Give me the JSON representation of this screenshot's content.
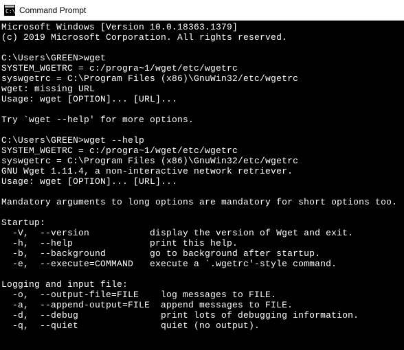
{
  "window": {
    "title": "Command Prompt",
    "icon": "cmd-icon"
  },
  "terminal": {
    "lines": [
      "Microsoft Windows [Version 10.0.18363.1379]",
      "(c) 2019 Microsoft Corporation. All rights reserved.",
      "",
      "C:\\Users\\GREEN>wget",
      "SYSTEM_WGETRC = c:/progra~1/wget/etc/wgetrc",
      "syswgetrc = C:\\Program Files (x86)\\GnuWin32/etc/wgetrc",
      "wget: missing URL",
      "Usage: wget [OPTION]... [URL]...",
      "",
      "Try `wget --help' for more options.",
      "",
      "C:\\Users\\GREEN>wget --help",
      "SYSTEM_WGETRC = c:/progra~1/wget/etc/wgetrc",
      "syswgetrc = C:\\Program Files (x86)\\GnuWin32/etc/wgetrc",
      "GNU Wget 1.11.4, a non-interactive network retriever.",
      "Usage: wget [OPTION]... [URL]...",
      "",
      "Mandatory arguments to long options are mandatory for short options too.",
      "",
      "Startup:",
      "  -V,  --version           display the version of Wget and exit.",
      "  -h,  --help              print this help.",
      "  -b,  --background        go to background after startup.",
      "  -e,  --execute=COMMAND   execute a `.wgetrc'-style command.",
      "",
      "Logging and input file:",
      "  -o,  --output-file=FILE    log messages to FILE.",
      "  -a,  --append-output=FILE  append messages to FILE.",
      "  -d,  --debug               print lots of debugging information.",
      "  -q,  --quiet               quiet (no output)."
    ]
  }
}
